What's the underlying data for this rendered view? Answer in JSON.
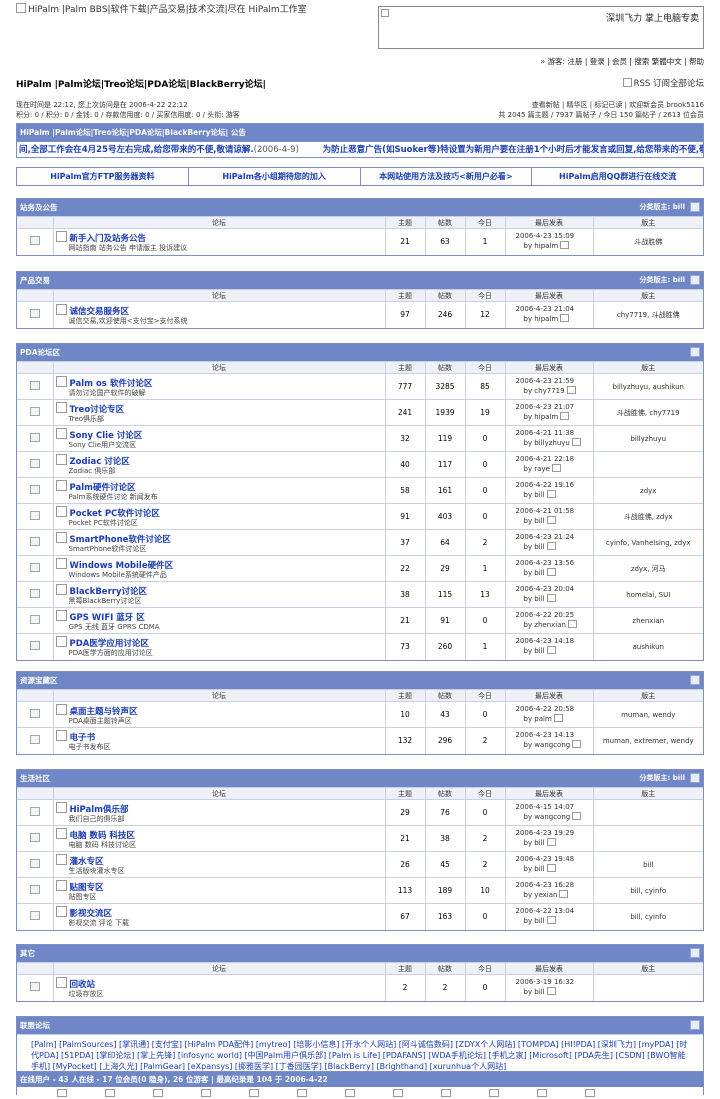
{
  "top": {
    "logo_alt": "HiPalm |Palm BBS|软件下载|产品交易|技术交流|尽在 HiPalm工作室",
    "banner_text": "深圳飞力 掌上电脑专卖"
  },
  "userbar": "» 游客: 注册 | 登录 | 会员 | 搜索 繁體中文 | 帮助",
  "navtitle": "HiPalm |Palm论坛|Treo论坛|PDA论坛|BlackBerry论坛|",
  "rss": "RSS 订阅全部论坛",
  "info_left": [
    "现在时间是 22:12, 您上次访问是在 2006-4-22 22:12",
    "积分: 0 / 积分: 0 / 金钱: 0 / 存款信用度: 0 / 买家信用度: 0 / 头衔: 游客"
  ],
  "info_right": [
    "查看新帖 | 精华区 | 标记已读 | 欢迎新会员 brook5116",
    "共 2045 篇主题 / 7937 篇帖子 / 今日 150 篇帖子 / 2613 位会员"
  ],
  "announce": {
    "title": "HiPalm |Palm论坛|Treo论坛|PDA论坛|BlackBerry论坛| 公告",
    "text": "间,全部工作会在4月25号左右完成,给您带来的不便,敬请谅解.",
    "date": "(2006-4-9)",
    "text2": "为防止恶意广告(如Suoker等)特设置为新用户要在注册1个小时后才能发言或回复,给您带来的不便,敬请"
  },
  "links": [
    "HiPalm官方FTP服务器资料",
    "HiPalm各小组期待您的加入",
    "本网站使用方法及技巧<新用户必看>",
    "HiPalm启用QQ群进行在线交流"
  ],
  "columns": [
    "论坛",
    "主题",
    "帖数",
    "今日",
    "最后发表",
    "版主"
  ],
  "sections": [
    {
      "title": "站务及公告",
      "mod": "分类版主: bill",
      "forums": [
        {
          "name": "新手入门及站务公告",
          "desc": "网站指南 站务公告 申请版主 投诉建议",
          "topics": "21",
          "posts": "63",
          "today": "1",
          "date": "2006-4-23 15:09",
          "by": "by hipalm",
          "mods": "斗战胜佛"
        }
      ]
    },
    {
      "title": "产品交易",
      "mod": "分类版主: bill",
      "forums": [
        {
          "name": "诚信交易服务区",
          "desc": "诚信交易,欢迎使用<支付宝>支付系统",
          "topics": "97",
          "posts": "246",
          "today": "12",
          "date": "2006-4-23 21:04",
          "by": "by hipalm",
          "mods": "chy7719, 斗战胜佛"
        }
      ]
    },
    {
      "title": "PDA论坛区",
      "mod": "",
      "forums": [
        {
          "name": "Palm os 软件讨论区",
          "desc": "请勿讨论国产软件的破解",
          "topics": "777",
          "posts": "3285",
          "today": "85",
          "date": "2006-4-23 21:59",
          "by": "by chy7719",
          "mods": "billyzhuyu, aushikun"
        },
        {
          "name": "Treo讨论专区",
          "desc": "Treo俱乐部",
          "topics": "241",
          "posts": "1939",
          "today": "19",
          "date": "2006-4-23 21:07",
          "by": "by hipalm",
          "mods": "斗战胜佛, chy7719"
        },
        {
          "name": "Sony Clie 讨论区",
          "desc": "Sony Clie用户交流区",
          "topics": "32",
          "posts": "119",
          "today": "0",
          "date": "2006-4-21 11:38",
          "by": "by billyzhuyu",
          "mods": "billyzhuyu"
        },
        {
          "name": "Zodiac 讨论区",
          "desc": "Zodiac 俱乐部",
          "topics": "40",
          "posts": "117",
          "today": "0",
          "date": "2006-4-21 22:18",
          "by": "by raye",
          "mods": ""
        },
        {
          "name": "Palm硬件讨论区",
          "desc": "Palm系统硬件讨论 新闻发布",
          "topics": "58",
          "posts": "161",
          "today": "0",
          "date": "2006-4-22 19:16",
          "by": "by bill",
          "mods": "zdyx"
        },
        {
          "name": "Pocket PC软件讨论区",
          "desc": "Pocket PC软件讨论区",
          "topics": "91",
          "posts": "403",
          "today": "0",
          "date": "2006-4-21 01:58",
          "by": "by bill",
          "mods": "斗战胜佛, zdyx"
        },
        {
          "name": "SmartPhone软件讨论区",
          "desc": "SmartPhone软件讨论区",
          "topics": "37",
          "posts": "64",
          "today": "2",
          "date": "2006-4-23 21:24",
          "by": "by bill",
          "mods": "cyinfo, Vanhelsing, zdyx"
        },
        {
          "name": "Windows Mobile硬件区",
          "desc": "Windows Mobile系统硬件产品",
          "topics": "22",
          "posts": "29",
          "today": "1",
          "date": "2006-4-23 13:56",
          "by": "by bill",
          "mods": "zdyx, 河马"
        },
        {
          "name": "BlackBerry讨论区",
          "desc": "黑莓BlackBerry讨论区",
          "topics": "38",
          "posts": "115",
          "today": "13",
          "date": "2006-4-23 20:04",
          "by": "by bill",
          "mods": "homelai, SUI"
        },
        {
          "name": "GPS WIFI 蓝牙 区",
          "desc": "GPS 无线 蓝牙 GPRS CDMA",
          "topics": "21",
          "posts": "91",
          "today": "0",
          "date": "2006-4-22 20:25",
          "by": "by zhenxian",
          "mods": "zhenxian"
        },
        {
          "name": "PDA医学应用讨论区",
          "desc": "PDA医学方面的应用讨论区",
          "topics": "73",
          "posts": "260",
          "today": "1",
          "date": "2006-4-23 14:18",
          "by": "by bill",
          "mods": "aushikun"
        }
      ]
    },
    {
      "title": "资源宝藏区",
      "mod": "",
      "forums": [
        {
          "name": "桌面主题与铃声区",
          "desc": "PDA桌面主题铃声区",
          "topics": "10",
          "posts": "43",
          "today": "0",
          "date": "2006-4-22 20:58",
          "by": "by palm",
          "mods": "muman, wendy"
        },
        {
          "name": "电子书",
          "desc": "电子书发布区",
          "topics": "132",
          "posts": "296",
          "today": "2",
          "date": "2006-4-23 14:13",
          "by": "by wangcong",
          "mods": "muman, extremer, wendy"
        }
      ]
    },
    {
      "title": "生活社区",
      "mod": "分类版主: bill",
      "forums": [
        {
          "name": "HiPalm俱乐部",
          "desc": "我们自己的俱乐部",
          "topics": "29",
          "posts": "76",
          "today": "0",
          "date": "2006-4-15 14:07",
          "by": "by wangcong",
          "mods": ""
        },
        {
          "name": "电脑 数码 科技区",
          "desc": "电脑 数码 科技讨论区",
          "topics": "21",
          "posts": "38",
          "today": "2",
          "date": "2006-4-23 19:29",
          "by": "by bill",
          "mods": ""
        },
        {
          "name": "灌水专区",
          "desc": "生活版块灌水专区",
          "topics": "26",
          "posts": "45",
          "today": "2",
          "date": "2006-4-23 19:48",
          "by": "by bill",
          "mods": "bill"
        },
        {
          "name": "贴图专区",
          "desc": "贴图专区",
          "topics": "113",
          "posts": "189",
          "today": "10",
          "date": "2006-4-23 16:28",
          "by": "by yexian",
          "mods": "bill, cyinfo"
        },
        {
          "name": "影视交流区",
          "desc": "影视交流 评论 下载",
          "topics": "67",
          "posts": "163",
          "today": "0",
          "date": "2006-4-22 13:04",
          "by": "by bill",
          "mods": "bill, cyinfo"
        }
      ]
    },
    {
      "title": "其它",
      "mod": "",
      "forums": [
        {
          "name": "回收站",
          "desc": "垃圾存放区",
          "topics": "2",
          "posts": "2",
          "today": "0",
          "date": "2006-3-19 16:32",
          "by": "by bill",
          "mods": ""
        }
      ]
    }
  ],
  "assoc": {
    "title": "联盟论坛",
    "text": "[Palm] [PalmSources] [掌讯通] [支付宝] [HiPalm PDA配件] [mytreo] [培影小信息] [开水个人网站] [阿斗诚信数码] [ZDYX个人网站] [TOMPDA] [HI!PDA] [深圳飞力] [myPDA] [时代PDA] [51PDA] [掌印论坛] [掌上先锋] [infosync world] [中国Palm用户俱乐部] [Palm is Life] [PDAFANS] [WDA手机论坛] [手机之家] [Microsoft] [PDA先生] [CSDN] [BWO智能手机] [MyPocket] [上海久光] [PalmGear] [eXpansys] [掷雅医学] [丁香园医学] [BlackBerry] [Brighthand] [xurunhua个人网站]"
  },
  "online": "在线用户 - 43 人在线 - 17 位会员(0 隐身), 26 位游客 | 最高纪录是 104 于 2006-4-22"
}
